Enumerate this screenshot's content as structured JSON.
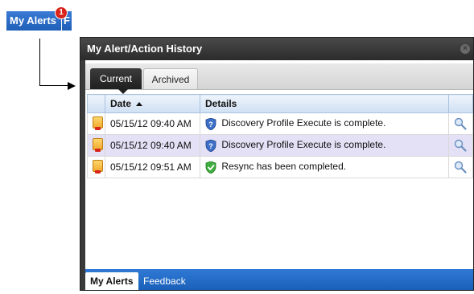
{
  "top_tab": {
    "label": "My Alerts",
    "next_label": "F",
    "badge_count": "1"
  },
  "window": {
    "title": "My Alert/Action History",
    "tabs": [
      {
        "label": "Current",
        "active": true
      },
      {
        "label": "Archived",
        "active": false
      }
    ],
    "table": {
      "columns": [
        "Date",
        "Details"
      ],
      "sort": {
        "column": "Date",
        "direction": "ascending"
      },
      "rows": [
        {
          "date": "05/15/12 09:40 AM",
          "details": "Discovery Profile Execute is complete.",
          "status_icon": "info-shield-icon",
          "selected": false
        },
        {
          "date": "05/15/12 09:40 AM",
          "details": "Discovery Profile Execute is complete.",
          "status_icon": "info-shield-icon",
          "selected": true
        },
        {
          "date": "05/15/12 09:51 AM",
          "details": "Resync has been completed.",
          "status_icon": "check-shield-icon",
          "selected": false
        }
      ]
    },
    "bottom_tabs": [
      {
        "label": "My Alerts",
        "active": true
      },
      {
        "label": "Feedback",
        "active": false
      }
    ]
  },
  "colors": {
    "accent_blue": "#1f5fb8",
    "title_bar": "#2b2b2b",
    "selected_row": "#e4e0f5",
    "badge_red": "#d9241b"
  }
}
